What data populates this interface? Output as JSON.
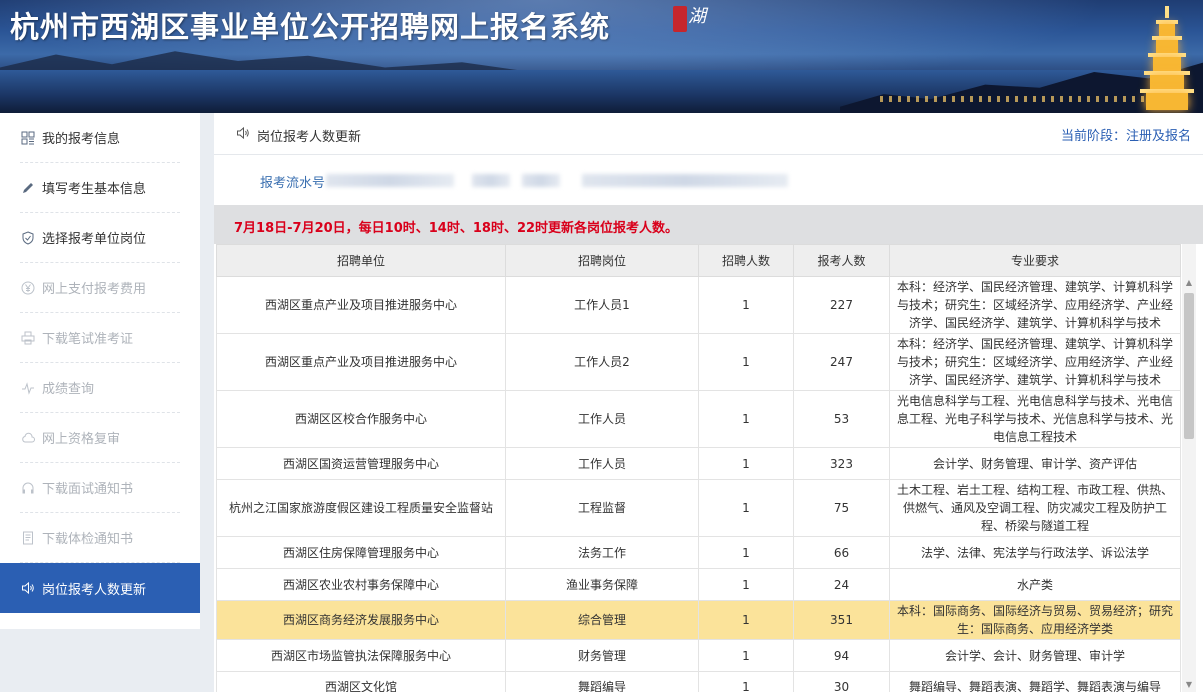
{
  "header": {
    "title": "杭州市西湖区事业单位公开招聘网上报名系统",
    "seal_text": "湖"
  },
  "sidebar": {
    "items": [
      {
        "label": "我的报考信息",
        "icon": "grid-icon",
        "state": "normal"
      },
      {
        "label": "填写考生基本信息",
        "icon": "pencil-icon",
        "state": "normal"
      },
      {
        "label": "选择报考单位岗位",
        "icon": "shield-check-icon",
        "state": "normal"
      },
      {
        "label": "网上支付报考费用",
        "icon": "yen-icon",
        "state": "disabled"
      },
      {
        "label": "下载笔试准考证",
        "icon": "printer-icon",
        "state": "disabled"
      },
      {
        "label": "成绩查询",
        "icon": "pulse-icon",
        "state": "disabled"
      },
      {
        "label": "网上资格复审",
        "icon": "cloud-icon",
        "state": "disabled"
      },
      {
        "label": "下载面试通知书",
        "icon": "headphones-icon",
        "state": "disabled"
      },
      {
        "label": "下载体检通知书",
        "icon": "document-icon",
        "state": "disabled"
      },
      {
        "label": "岗位报考人数更新",
        "icon": "speaker-icon",
        "state": "active"
      }
    ]
  },
  "main": {
    "title": "岗位报考人数更新",
    "stage": "当前阶段：注册及报名",
    "serial_label": "报考流水号",
    "notice": "7月18日-7月20日，每日10时、14时、18时、22时更新各岗位报考人数。"
  },
  "table": {
    "headers": [
      "招聘单位",
      "招聘岗位",
      "招聘人数",
      "报考人数",
      "专业要求"
    ],
    "rows": [
      {
        "unit": "西湖区重点产业及项目推进服务中心",
        "post": "工作人员1",
        "quota": "1",
        "applicants": "227",
        "major": "本科：经济学、国民经济管理、建筑学、计算机科学与技术；研究生：区域经济学、应用经济学、产业经济学、国民经济学、建筑学、计算机科学与技术",
        "highlight": false
      },
      {
        "unit": "西湖区重点产业及项目推进服务中心",
        "post": "工作人员2",
        "quota": "1",
        "applicants": "247",
        "major": "本科：经济学、国民经济管理、建筑学、计算机科学与技术；研究生：区域经济学、应用经济学、产业经济学、国民经济学、建筑学、计算机科学与技术",
        "highlight": false
      },
      {
        "unit": "西湖区区校合作服务中心",
        "post": "工作人员",
        "quota": "1",
        "applicants": "53",
        "major": "光电信息科学与工程、光电信息科学与技术、光电信息工程、光电子科学与技术、光信息科学与技术、光电信息工程技术",
        "highlight": false
      },
      {
        "unit": "西湖区国资运营管理服务中心",
        "post": "工作人员",
        "quota": "1",
        "applicants": "323",
        "major": "会计学、财务管理、审计学、资产评估",
        "highlight": false
      },
      {
        "unit": "杭州之江国家旅游度假区建设工程质量安全监督站",
        "post": "工程监督",
        "quota": "1",
        "applicants": "75",
        "major": "土木工程、岩土工程、结构工程、市政工程、供热、供燃气、通风及空调工程、防灾减灾工程及防护工程、桥梁与隧道工程",
        "highlight": false
      },
      {
        "unit": "西湖区住房保障管理服务中心",
        "post": "法务工作",
        "quota": "1",
        "applicants": "66",
        "major": "法学、法律、宪法学与行政法学、诉讼法学",
        "highlight": false
      },
      {
        "unit": "西湖区农业农村事务保障中心",
        "post": "渔业事务保障",
        "quota": "1",
        "applicants": "24",
        "major": "水产类",
        "highlight": false
      },
      {
        "unit": "西湖区商务经济发展服务中心",
        "post": "综合管理",
        "quota": "1",
        "applicants": "351",
        "major": "本科：国际商务、国际经济与贸易、贸易经济；研究生：国际商务、应用经济学类",
        "highlight": true
      },
      {
        "unit": "西湖区市场监管执法保障服务中心",
        "post": "财务管理",
        "quota": "1",
        "applicants": "94",
        "major": "会计学、会计、财务管理、审计学",
        "highlight": false
      },
      {
        "unit": "西湖区文化馆",
        "post": "舞蹈编导",
        "quota": "1",
        "applicants": "30",
        "major": "舞蹈编导、舞蹈表演、舞蹈学、舞蹈表演与编导",
        "highlight": false
      }
    ]
  },
  "colors": {
    "accent": "#2b5fb3",
    "notice_red": "#d9001b",
    "highlight_row": "#fbe39a"
  }
}
